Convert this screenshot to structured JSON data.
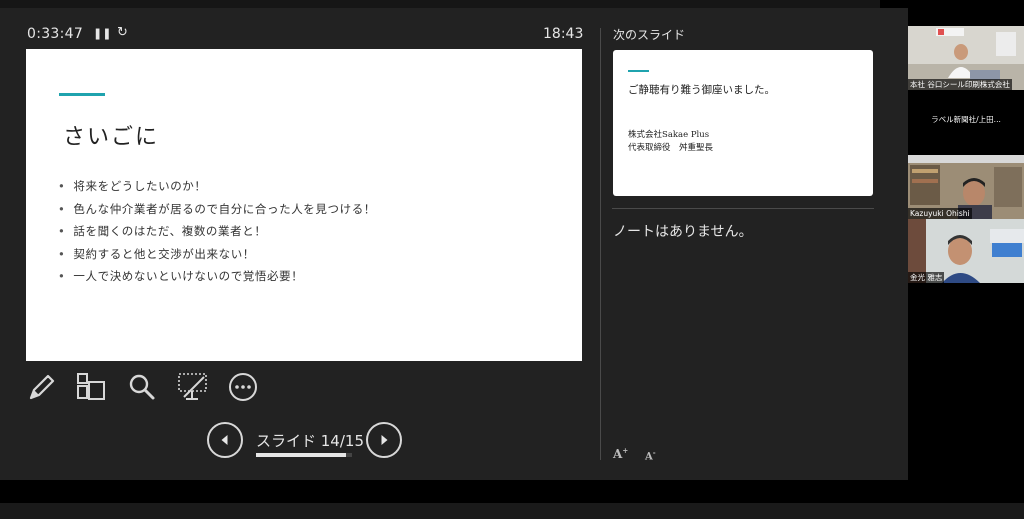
{
  "presenter": {
    "elapsed_time": "0:33:47",
    "pause_symbol": "❚❚",
    "reset_symbol": "↻",
    "clock": "18:43",
    "next_slide_label": "次のスライド",
    "notes_text": "ノートはありません。",
    "font_increase_label": "A",
    "font_increase_sup": "+",
    "font_decrease_label": "A",
    "font_decrease_sup": "-"
  },
  "current_slide": {
    "title": "さいごに",
    "bullets": [
      "将来をどうしたいのか！",
      "色んな仲介業者が居るので自分に合った人を見つける！",
      "話を聞くのはただ、複数の業者と！",
      "契約すると他と交渉が出来ない！",
      "一人で決めないといけないので覚悟必要！"
    ],
    "accent_color": "#1fa3ae"
  },
  "next_slide": {
    "title": "ご静聴有り難う御座いました。",
    "company": "株式会社Sakae Plus",
    "person": "代表取締役　舛重聖長"
  },
  "toolbar": {
    "icons": [
      "pen-icon",
      "all-slides-icon",
      "magnifier-icon",
      "screen-off-icon",
      "more-icon"
    ]
  },
  "navigation": {
    "counter_label": "スライド 14/15",
    "current": 14,
    "total": 15
  },
  "participants": [
    {
      "label": "本社 谷口シール印刷株式会社"
    },
    {
      "label": "ラベル新聞社/上田..."
    },
    {
      "label": "Kazuyuki Ohishi"
    },
    {
      "label": "金光 雅志"
    }
  ]
}
